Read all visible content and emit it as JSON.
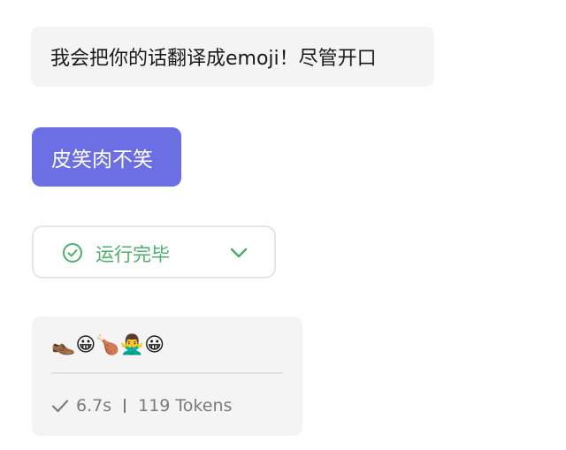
{
  "messages": {
    "assistant_intro": "我会把你的话翻译成emoji！尽管开口",
    "user_text": "皮笑肉不笑"
  },
  "status": {
    "label": "运行完毕",
    "icon": "check-circle-icon",
    "accent_color": "#4caf6a"
  },
  "result": {
    "emoji": "👞😀🍗🙅‍♂️😀",
    "duration": "6.7s",
    "tokens": "119 Tokens"
  },
  "colors": {
    "user_bubble": "#6b6fe3",
    "card_bg": "#f4f4f5",
    "meta_text": "#7a7a80"
  }
}
